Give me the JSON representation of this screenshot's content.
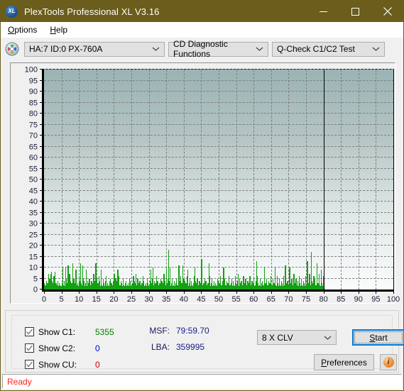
{
  "window": {
    "title": "PlexTools Professional XL V3.16",
    "app_icon": "xl-logo-icon",
    "minimize_label": "Minimize",
    "maximize_label": "Maximize",
    "close_label": "Close"
  },
  "menubar": {
    "items": [
      {
        "label": "Options",
        "accel": "O"
      },
      {
        "label": "Help",
        "accel": "H"
      }
    ]
  },
  "toolbar": {
    "disc_icon": "optical-disc-icon",
    "drive_select": "HA:7 ID:0  PX-760A",
    "function_select": "CD Diagnostic Functions",
    "test_select": "Q-Check C1/C2 Test"
  },
  "chart_data": {
    "type": "bar",
    "title": "",
    "xlabel": "",
    "ylabel": "",
    "xlim": [
      0,
      100
    ],
    "ylim": [
      0,
      100
    ],
    "grid": true,
    "legend": "none",
    "series_name": "C1 errors",
    "series_color": "#13a013",
    "background_gradient_top": "#9ab3b4",
    "background_gradient_bottom": "#fafcfc",
    "data_end_marker_x": 80,
    "ytick_labels": [
      0,
      5,
      10,
      15,
      20,
      25,
      30,
      35,
      40,
      45,
      50,
      55,
      60,
      65,
      70,
      75,
      80,
      85,
      90,
      95,
      100
    ],
    "xtick_labels": [
      0,
      5,
      10,
      15,
      20,
      25,
      30,
      35,
      40,
      45,
      50,
      55,
      60,
      65,
      70,
      75,
      80,
      85,
      90,
      95,
      100
    ],
    "x": [
      0.0,
      0.3,
      0.6,
      0.9,
      1.2,
      1.5,
      1.8,
      2.1,
      2.4,
      2.7,
      3.0,
      3.3,
      3.6,
      3.9,
      4.2,
      4.5,
      4.8,
      5.1,
      5.4,
      5.7,
      6.0,
      6.3,
      6.6,
      6.9,
      7.2,
      7.5,
      7.8,
      8.1,
      8.4,
      8.7,
      9.0,
      9.3,
      9.6,
      9.9,
      10.2,
      10.5,
      10.8,
      11.1,
      11.4,
      11.7,
      12.0,
      12.3,
      12.6,
      12.9,
      13.2,
      13.5,
      13.8,
      14.1,
      14.4,
      14.7,
      15.0,
      15.3,
      15.6,
      15.9,
      16.2,
      16.5,
      16.8,
      17.1,
      17.4,
      17.7,
      18.0,
      18.3,
      18.6,
      18.9,
      19.2,
      19.5,
      19.8,
      20.1,
      20.4,
      20.7,
      21.0,
      21.3,
      21.6,
      21.9,
      22.2,
      22.5,
      22.8,
      23.1,
      23.4,
      23.7,
      24.0,
      24.3,
      24.6,
      24.9,
      25.2,
      25.5,
      25.8,
      26.1,
      26.4,
      26.7,
      27.0,
      27.3,
      27.6,
      27.9,
      28.2,
      28.5,
      28.8,
      29.1,
      29.4,
      29.7,
      30.0,
      30.3,
      30.6,
      30.9,
      31.2,
      31.5,
      31.8,
      32.1,
      32.4,
      32.7,
      33.0,
      33.3,
      33.6,
      33.9,
      34.2,
      34.5,
      34.8,
      35.1,
      35.4,
      35.7,
      36.0,
      36.3,
      36.6,
      36.9,
      37.2,
      37.5,
      37.8,
      38.1,
      38.4,
      38.7,
      39.0,
      39.3,
      39.6,
      39.9,
      40.2,
      40.5,
      40.8,
      41.1,
      41.4,
      41.7,
      42.0,
      42.3,
      42.6,
      42.9,
      43.2,
      43.5,
      43.8,
      44.1,
      44.4,
      44.7,
      45.0,
      45.3,
      45.6,
      45.9,
      46.2,
      46.5,
      46.8,
      47.1,
      47.4,
      47.7,
      48.0,
      48.3,
      48.6,
      48.9,
      49.2,
      49.5,
      49.8,
      50.1,
      50.4,
      50.7,
      51.0,
      51.3,
      51.6,
      51.9,
      52.2,
      52.5,
      52.8,
      53.1,
      53.4,
      53.7,
      54.0,
      54.3,
      54.6,
      54.9,
      55.2,
      55.5,
      55.8,
      56.1,
      56.4,
      56.7,
      57.0,
      57.3,
      57.6,
      57.9,
      58.2,
      58.5,
      58.8,
      59.1,
      59.4,
      59.7,
      60.0,
      60.3,
      60.6,
      60.9,
      61.2,
      61.5,
      61.8,
      62.1,
      62.4,
      62.7,
      63.0,
      63.3,
      63.6,
      63.9,
      64.2,
      64.5,
      64.8,
      65.1,
      65.4,
      65.7,
      66.0,
      66.3,
      66.6,
      66.9,
      67.2,
      67.5,
      67.8,
      68.1,
      68.4,
      68.7,
      69.0,
      69.3,
      69.6,
      69.9,
      70.2,
      70.5,
      70.8,
      71.1,
      71.4,
      71.7,
      72.0,
      72.3,
      72.6,
      72.9,
      73.2,
      73.5,
      73.8,
      74.1,
      74.4,
      74.7,
      75.0,
      75.3,
      75.6,
      75.9,
      76.2,
      76.5,
      76.8,
      77.1,
      77.4,
      77.7,
      78.0,
      78.3,
      78.6,
      78.9,
      79.2,
      79.5,
      79.8
    ],
    "values": [
      3,
      2,
      4,
      3,
      2,
      5,
      7,
      4,
      3,
      6,
      8,
      3,
      2,
      4,
      3,
      2,
      1,
      3,
      2,
      4,
      10,
      5,
      3,
      2,
      7,
      4,
      3,
      12,
      5,
      3,
      4,
      2,
      3,
      6,
      4,
      3,
      2,
      5,
      4,
      3,
      9,
      4,
      3,
      5,
      2,
      4,
      3,
      7,
      4,
      12,
      5,
      3,
      6,
      4,
      3,
      2,
      5,
      3,
      4,
      6,
      3,
      2,
      4,
      5,
      3,
      2,
      4,
      3,
      5,
      4,
      9,
      3,
      2,
      4,
      3,
      5,
      2,
      3,
      4,
      2,
      3,
      5,
      4,
      2,
      3,
      6,
      4,
      3,
      2,
      5,
      3,
      4,
      2,
      3,
      6,
      4,
      2,
      3,
      5,
      3,
      2,
      4,
      3,
      5,
      2,
      4,
      3,
      6,
      4,
      2,
      3,
      5,
      4,
      3,
      7,
      4,
      2,
      3,
      5,
      4,
      2,
      3,
      5,
      2,
      4,
      3,
      5,
      2,
      3,
      4,
      6,
      3,
      2,
      5,
      4,
      3,
      6,
      2,
      3,
      5,
      4,
      2,
      3,
      6,
      4,
      3,
      5,
      2,
      4,
      3,
      6,
      2,
      3,
      5,
      4,
      2,
      3,
      4,
      6,
      3,
      5,
      2,
      4,
      3,
      2,
      5,
      4,
      3,
      6,
      2,
      4,
      3,
      5,
      2,
      4,
      3,
      6,
      2,
      3,
      5,
      4,
      2,
      6,
      3,
      4,
      2,
      5,
      3,
      4,
      2,
      6,
      3,
      5,
      2,
      4,
      3,
      6,
      2,
      4,
      3,
      5,
      2,
      4,
      6,
      3,
      2,
      5,
      3,
      4,
      2,
      6,
      3,
      5,
      2,
      4,
      3,
      6,
      2,
      5,
      3,
      4,
      2,
      6,
      3,
      5,
      2,
      4,
      3,
      6,
      2,
      5,
      3,
      4,
      2,
      6,
      3,
      5,
      2,
      7,
      3,
      5,
      2,
      4,
      6,
      3,
      5,
      2,
      4,
      3,
      6,
      2,
      5,
      3,
      7,
      2,
      4,
      3,
      6,
      5,
      2,
      4,
      3,
      7,
      2,
      5,
      3,
      6,
      4,
      2,
      5,
      3,
      7,
      4,
      2,
      5,
      3,
      6,
      4,
      2,
      5,
      3,
      7,
      4,
      2,
      6,
      3,
      5,
      4,
      2,
      6,
      3
    ],
    "peaks": [
      {
        "x": 1.2,
        "y": 7
      },
      {
        "x": 2.0,
        "y": 8
      },
      {
        "x": 5.2,
        "y": 10
      },
      {
        "x": 6.8,
        "y": 11
      },
      {
        "x": 9.0,
        "y": 9
      },
      {
        "x": 10.4,
        "y": 12
      },
      {
        "x": 10.9,
        "y": 11
      },
      {
        "x": 16.3,
        "y": 9
      },
      {
        "x": 20.0,
        "y": 7
      },
      {
        "x": 21.2,
        "y": 6
      },
      {
        "x": 26.2,
        "y": 7
      },
      {
        "x": 30.5,
        "y": 9
      },
      {
        "x": 31.1,
        "y": 10
      },
      {
        "x": 34.9,
        "y": 10
      },
      {
        "x": 35.6,
        "y": 18
      },
      {
        "x": 36.0,
        "y": 10
      },
      {
        "x": 38.5,
        "y": 11
      },
      {
        "x": 39.6,
        "y": 11
      },
      {
        "x": 41.1,
        "y": 9
      },
      {
        "x": 43.0,
        "y": 10
      },
      {
        "x": 45.0,
        "y": 14
      },
      {
        "x": 47.2,
        "y": 12
      },
      {
        "x": 51.3,
        "y": 10
      },
      {
        "x": 55.5,
        "y": 7
      },
      {
        "x": 60.8,
        "y": 13
      },
      {
        "x": 63.0,
        "y": 10
      },
      {
        "x": 66.0,
        "y": 10
      },
      {
        "x": 69.0,
        "y": 11
      },
      {
        "x": 70.2,
        "y": 10
      },
      {
        "x": 75.3,
        "y": 13
      },
      {
        "x": 76.4,
        "y": 17
      },
      {
        "x": 78.0,
        "y": 12
      },
      {
        "x": 79.3,
        "y": 9
      }
    ]
  },
  "stats": {
    "checkboxes": [
      {
        "label": "Show C1:",
        "value": "5355",
        "color": "#008000",
        "checked": true
      },
      {
        "label": "Show C2:",
        "value": "0",
        "color": "#0000cc",
        "checked": true
      },
      {
        "label": "Show CU:",
        "value": "0",
        "color": "#cc0000",
        "checked": true
      }
    ],
    "msf_key": "MSF:",
    "msf_value": "79:59.70",
    "lba_key": "LBA:",
    "lba_value": "359995"
  },
  "controls": {
    "speed_select": "8 X CLV",
    "start_label": "Start",
    "start_accel": "S",
    "preferences_label": "Preferences",
    "preferences_accel": "P",
    "info_icon": "info-icon",
    "info_glyph": "i"
  },
  "statusbar": {
    "text": "Ready",
    "color": "#ff2020"
  }
}
